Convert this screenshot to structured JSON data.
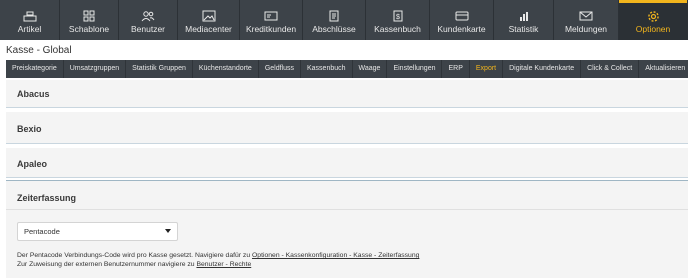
{
  "topnav": {
    "items": [
      {
        "label": "Artikel",
        "icon": "cash-register-icon"
      },
      {
        "label": "Schablone",
        "icon": "grid-icon"
      },
      {
        "label": "Benutzer",
        "icon": "users-icon"
      },
      {
        "label": "Mediacenter",
        "icon": "image-icon"
      },
      {
        "label": "Kreditkunden",
        "icon": "id-card-icon"
      },
      {
        "label": "Abschlüsse",
        "icon": "document-icon"
      },
      {
        "label": "Kassenbuch",
        "icon": "book-icon"
      },
      {
        "label": "Kundenkarte",
        "icon": "card-icon"
      },
      {
        "label": "Statistik",
        "icon": "bar-chart-icon"
      },
      {
        "label": "Meldungen",
        "icon": "envelope-icon"
      },
      {
        "label": "Optionen",
        "icon": "gear-icon"
      }
    ],
    "active": "Optionen"
  },
  "page": {
    "title": "Kasse - Global"
  },
  "subnav": {
    "items": [
      "Preiskategorie",
      "Umsatzgruppen",
      "Statistik Gruppen",
      "Küchenstandorte",
      "Geldfluss",
      "Kassenbuch",
      "Waage",
      "Einstellungen",
      "ERP",
      "Export",
      "Digitale Kundenkarte",
      "Click & Collect",
      "Aktualisieren",
      "Üb"
    ],
    "active": "Export"
  },
  "sections": {
    "abacus": "Abacus",
    "bexio": "Bexio",
    "apaleo": "Apaleo",
    "zeiterfassung": "Zeiterfassung"
  },
  "zeiterfassung": {
    "select_value": "Pentacode",
    "info1_text": "Der Pentacode Verbindungs-Code wird pro Kasse gesetzt. Navigiere dafür zu ",
    "info1_link": "Optionen - Kassenkonfiguration - Kasse - Zeiterfassung",
    "info2_text": "Zur Zuweisung der externen Benutzernummer navigiere zu ",
    "info2_link": "Benutzer - Rechte"
  },
  "colors": {
    "nav_bg": "#3d4349",
    "accent": "#f2b51d",
    "section_bg": "#f4f4f4"
  }
}
